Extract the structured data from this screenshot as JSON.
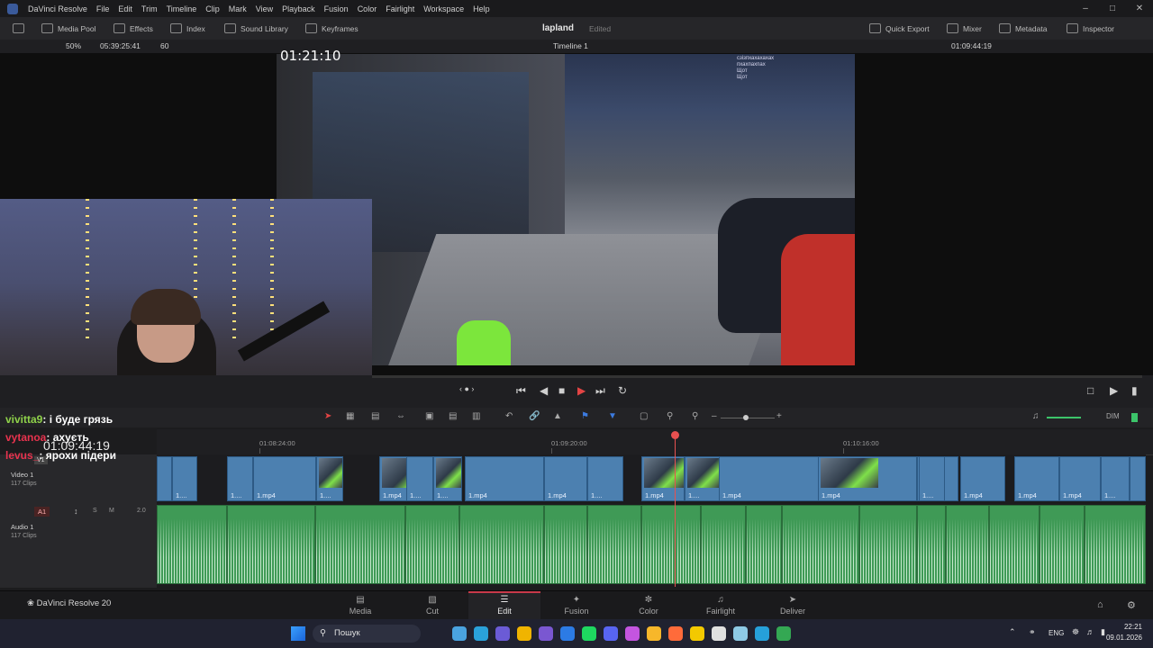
{
  "menubar": {
    "app_name": "DaVinci Resolve",
    "items": [
      "File",
      "Edit",
      "Trim",
      "Timeline",
      "Clip",
      "Mark",
      "View",
      "Playback",
      "Fusion",
      "Color",
      "Fairlight",
      "Workspace",
      "Help"
    ]
  },
  "toolbar": {
    "media_pool": "Media Pool",
    "effects": "Effects",
    "index": "Index",
    "sound_library": "Sound Library",
    "keyframes": "Keyframes",
    "project_name": "lapland",
    "project_status": "Edited",
    "quick_export": "Quick Export",
    "mixer": "Mixer",
    "metadata": "Metadata",
    "inspector": "Inspector"
  },
  "viewer": {
    "zoom": "50%",
    "source_timecode": "05:39:25:41",
    "fps": "60",
    "timeline_name": "Timeline 1",
    "record_timecode": "01:09:44:19",
    "overlay_timecode": "01:21:10"
  },
  "stream_overlay": {
    "chat": [
      {
        "user": "vivitta9",
        "message": ": і буде грязь"
      },
      {
        "user": "vytanoa",
        "message": ": ахуєть"
      },
      {
        "user": "levus_",
        "message": ": ярохи підери"
      }
    ],
    "timecode": "01:09:44:19",
    "video_chat_lines": [
      "сзізпхахахахах",
      "пхахпахпах",
      "Щот",
      "Щот"
    ]
  },
  "timeline": {
    "ruler": [
      "01:08:24:00",
      "01:09:20:00",
      "01:10:16:00"
    ],
    "dim_label": "DIM",
    "video_track": {
      "tag": "V1",
      "name": "Video 1",
      "count": "117 Clips"
    },
    "audio_track": {
      "tag": "A1",
      "name": "Audio 1",
      "count": "117 Clips",
      "level": "2.0",
      "solo": "S",
      "mute": "M"
    },
    "clip_label": "1.mp4",
    "short_clip_label": "1....",
    "playhead_seconds_from_start": 80
  },
  "pages": [
    "Media",
    "Cut",
    "Edit",
    "Fusion",
    "Color",
    "Fairlight",
    "Deliver"
  ],
  "active_page": "Edit",
  "brand": "DaVinci Resolve 20",
  "taskbar": {
    "search_placeholder": "Пошук",
    "lang": "ENG",
    "time": "22:21",
    "date": "09.01.2026"
  },
  "colors": {
    "accent": "#c8394a",
    "video_clip": "#4c80b0",
    "audio_clip": "#3f9a56",
    "playhead": "#e85050"
  }
}
